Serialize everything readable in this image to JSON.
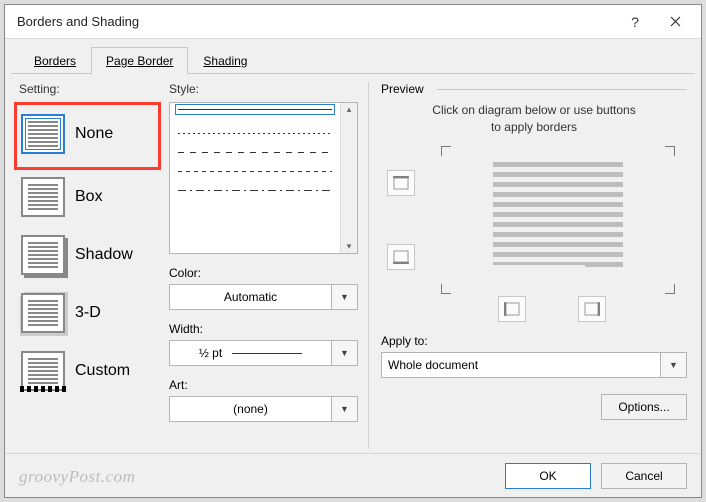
{
  "window": {
    "title": "Borders and Shading"
  },
  "tabs": {
    "borders": "Borders",
    "pageBorder": "Page Border",
    "shading": "Shading",
    "active": "Page Border"
  },
  "setting": {
    "label": "Setting:",
    "items": [
      {
        "label": "None",
        "selected": true
      },
      {
        "label": "Box"
      },
      {
        "label": "Shadow"
      },
      {
        "label": "3-D"
      },
      {
        "label": "Custom"
      }
    ]
  },
  "style": {
    "label": "Style:"
  },
  "color": {
    "label": "Color:",
    "value": "Automatic"
  },
  "width": {
    "label": "Width:",
    "value": "½ pt"
  },
  "art": {
    "label": "Art:",
    "value": "(none)"
  },
  "preview": {
    "label": "Preview",
    "msg1": "Click on diagram below or use buttons",
    "msg2": "to apply borders"
  },
  "applyTo": {
    "label": "Apply to:",
    "value": "Whole document"
  },
  "buttons": {
    "options": "Options...",
    "ok": "OK",
    "cancel": "Cancel"
  },
  "watermark": "groovyPost.com"
}
